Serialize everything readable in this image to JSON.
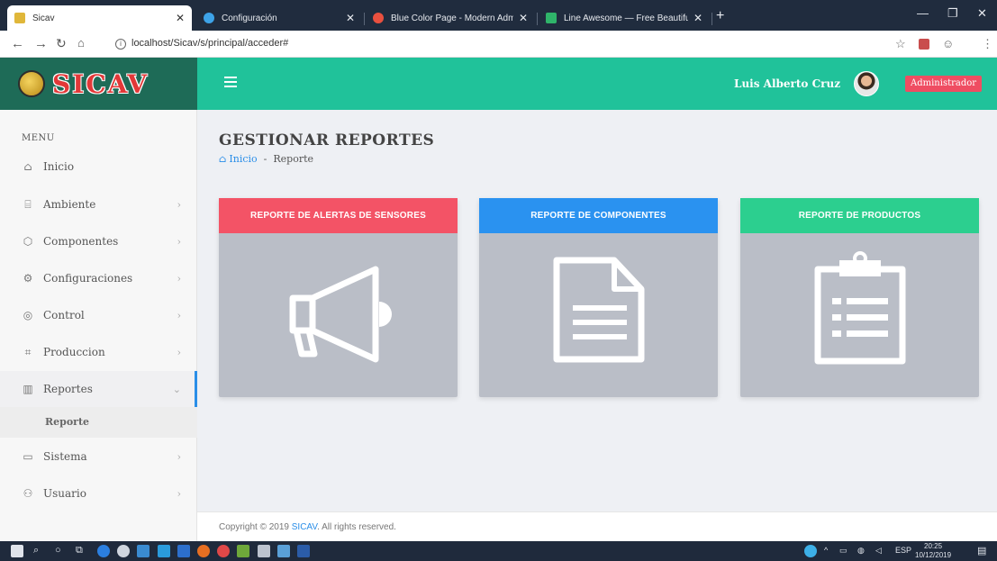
{
  "browser": {
    "tabs": [
      {
        "label": "Sicav",
        "icon": "sicav-favicon",
        "active": true
      },
      {
        "label": "Configuración",
        "icon": "gear-favicon",
        "active": false
      },
      {
        "label": "Blue Color Page - Modern Admin",
        "icon": "admin-favicon",
        "active": false
      },
      {
        "label": "Line Awesome — Free Beautiful I",
        "icon": "lineawesome-favicon",
        "active": false
      }
    ],
    "url": "localhost/Sicav/s/principal/acceder#"
  },
  "app": {
    "brand": "SICAV",
    "user_name": "Luis Alberto Cruz",
    "role": "Administrador",
    "accent": "#20c29a"
  },
  "sidebar": {
    "menu_title": "MENU",
    "items": [
      {
        "label": "Inicio",
        "icon": "home-icon"
      },
      {
        "label": "Ambiente",
        "icon": "bank-icon"
      },
      {
        "label": "Componentes",
        "icon": "component-icon"
      },
      {
        "label": "Configuraciones",
        "icon": "settings-icon"
      },
      {
        "label": "Control",
        "icon": "control-icon"
      },
      {
        "label": "Produccion",
        "icon": "production-icon"
      },
      {
        "label": "Reportes",
        "icon": "chart-icon"
      },
      {
        "label": "Sistema",
        "icon": "terminal-icon"
      },
      {
        "label": "Usuario",
        "icon": "users-icon"
      }
    ],
    "subitem": "Reporte"
  },
  "main": {
    "title": "GESTIONAR REPORTES",
    "breadcrumb": {
      "home": "Inicio",
      "separator": "-",
      "current": "Reporte"
    },
    "cards": [
      {
        "title": "REPORTE DE ALERTAS DE SENSORES",
        "color": "#f35366",
        "icon": "megaphone-icon"
      },
      {
        "title": "REPORTE DE COMPONENTES",
        "color": "#2a92f0",
        "icon": "document-icon"
      },
      {
        "title": "REPORTE DE PRODUCTOS",
        "color": "#2ccf8f",
        "icon": "clipboard-icon"
      }
    ]
  },
  "footer": {
    "prefix": "Copyright © 2019",
    "link": "SICAV",
    "suffix": ". All rights reserved."
  },
  "taskbar": {
    "language": "ESP",
    "time": "20:25",
    "date": "10/12/2019"
  }
}
